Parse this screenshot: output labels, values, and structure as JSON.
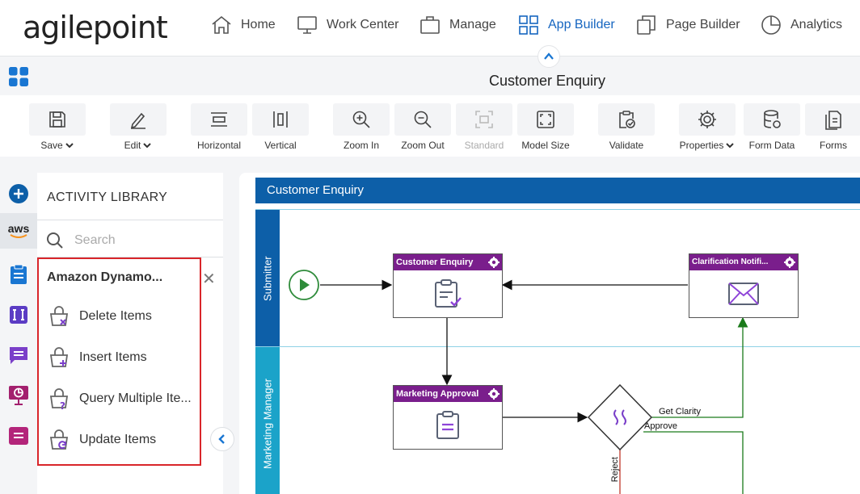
{
  "brand": {
    "logo_text": "agilepoint"
  },
  "nav": {
    "items": [
      {
        "label": "Home",
        "icon": "home-icon"
      },
      {
        "label": "Work Center",
        "icon": "monitor-icon"
      },
      {
        "label": "Manage",
        "icon": "briefcase-icon"
      },
      {
        "label": "App Builder",
        "icon": "grid-icon",
        "active": true
      },
      {
        "label": "Page Builder",
        "icon": "copy-icon"
      },
      {
        "label": "Analytics",
        "icon": "pie-chart-icon"
      }
    ],
    "accent_color": "#1565c0"
  },
  "page": {
    "title": "Customer Enquiry"
  },
  "toolbar": {
    "save": "Save",
    "edit": "Edit",
    "horizontal": "Horizontal",
    "vertical": "Vertical",
    "zoom_in": "Zoom In",
    "zoom_out": "Zoom Out",
    "standard": "Standard",
    "model_size": "Model Size",
    "validate": "Validate",
    "properties": "Properties",
    "form_data": "Form Data",
    "forms": "Forms"
  },
  "rail": {
    "aws_label": "aws"
  },
  "library": {
    "title": "ACTIVITY LIBRARY",
    "search_placeholder": "Search",
    "group_title": "Amazon Dynamo...",
    "close_glyph": "✕",
    "items": [
      {
        "label": "Delete Items",
        "icon": "delete-items-icon"
      },
      {
        "label": "Insert Items",
        "icon": "insert-items-icon"
      },
      {
        "label": "Query Multiple Ite...",
        "icon": "query-items-icon"
      },
      {
        "label": "Update Items",
        "icon": "update-items-icon"
      }
    ],
    "highlight_color": "#d9252a"
  },
  "canvas": {
    "pool_title": "Customer Enquiry",
    "lanes": [
      {
        "label": "Submitter",
        "color": "#0d5fa8"
      },
      {
        "label": "Marketing Manager",
        "color": "#1ba3c9"
      }
    ],
    "tasks": [
      {
        "title": "Customer Enquiry"
      },
      {
        "title": "Clarification Notifi..."
      },
      {
        "title": "Marketing Approval"
      }
    ],
    "flow_labels": {
      "get_clarity": "Get Clarity",
      "approve": "Approve",
      "reject": "Reject"
    },
    "task_header_color": "#7a1e8c"
  }
}
